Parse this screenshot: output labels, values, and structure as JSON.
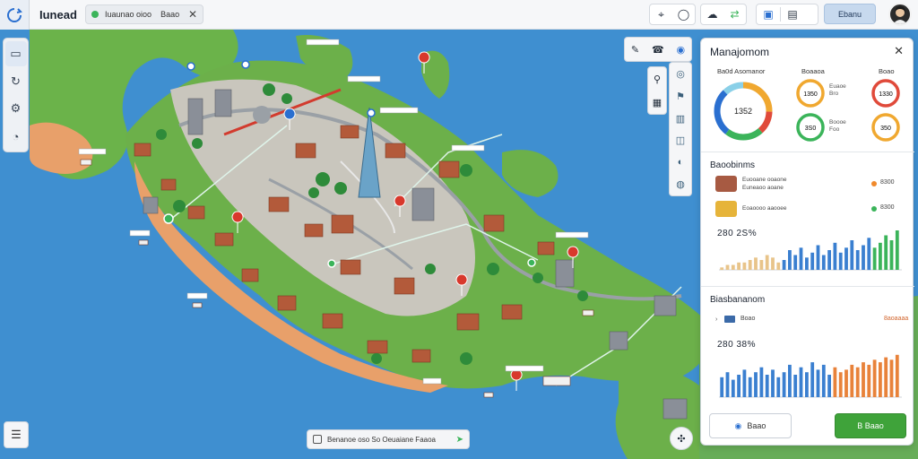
{
  "app": {
    "title": "Iunead",
    "logo": "refresh-circle-icon"
  },
  "search_chip": {
    "text": "Iuaunao oioo",
    "text2": "Baao",
    "status_color": "#3bb45a"
  },
  "toolbar": {
    "share_label": "Ebanu",
    "icons": [
      "location-icon",
      "circle-icon",
      "weather-icon",
      "transfer-icon",
      "photo-icon",
      "panel-icon"
    ]
  },
  "left_tools": [
    "map-icon",
    "route-icon",
    "settings-icon",
    "time-icon"
  ],
  "right_tools": {
    "top": [
      "pencil-icon",
      "phone-icon",
      "globe-icon"
    ],
    "col1": [
      "pin-icon",
      "cube-icon"
    ],
    "col2": [
      "globe-icon",
      "flag-icon",
      "bus-icon",
      "layers-icon",
      "speed-icon",
      "eye-icon"
    ]
  },
  "status_chip": {
    "text": "Benanoe oso So Oeuaiane Faaoa"
  },
  "panel": {
    "title": "Manajomom",
    "overview_label": "Ba0d Asomanor",
    "donut_value": "1352",
    "rings": [
      {
        "title": "Boaaoa",
        "value": "1350",
        "color": "#f0a830",
        "side": [
          "Euaoe",
          "Bro"
        ]
      },
      {
        "title": "Boao",
        "value": "1330",
        "color": "#e04a3a",
        "side": []
      },
      {
        "title": "",
        "value": "3S0",
        "color": "#3bb45a",
        "side": [
          "Boooe",
          "Foo"
        ]
      },
      {
        "title": "",
        "value": "350",
        "color": "#f0a830",
        "side": []
      }
    ],
    "section1_title": "Baoobinms",
    "legend1": [
      {
        "name": "Euooane ooaone",
        "sub": "Euneaoo aoane",
        "value": "8300",
        "dot": "#f08a2c",
        "thumb": "#a75a42"
      },
      {
        "name": "Eoaoooo aaooee",
        "sub": "",
        "value": "8300",
        "dot": "#3bb45a",
        "thumb": "#e6b43a"
      }
    ],
    "stat1": "280 2S%",
    "section2_title": "Biasbananom",
    "row2": {
      "text": "Boao",
      "value": "8aoaaaa"
    },
    "stat2": "280 38%",
    "reset_label": "Baao",
    "apply_label": "B Baao"
  },
  "chart_data": [
    {
      "type": "bar",
      "title": "",
      "categories": [
        "1",
        "2",
        "3",
        "4",
        "5",
        "6",
        "7",
        "8",
        "9",
        "10",
        "11",
        "12",
        "13",
        "14",
        "15",
        "16",
        "17",
        "18",
        "19",
        "20",
        "21",
        "22",
        "23",
        "24",
        "25",
        "26",
        "27",
        "28",
        "29",
        "30",
        "31",
        "32"
      ],
      "series": [
        {
          "values": [
            1,
            2,
            2,
            3,
            3,
            4,
            5,
            4,
            6,
            5,
            3,
            4,
            8,
            6,
            9,
            5,
            7,
            10,
            6,
            8,
            11,
            7,
            9,
            12,
            8,
            10,
            13,
            9,
            11,
            14,
            12,
            16
          ]
        }
      ],
      "colors_rule": "first third orange-tan, then blue, last few green",
      "ylim": [
        0,
        16
      ]
    },
    {
      "type": "bar",
      "title": "",
      "categories": [
        "1",
        "2",
        "3",
        "4",
        "5",
        "6",
        "7",
        "8",
        "9",
        "10",
        "11",
        "12",
        "13",
        "14",
        "15",
        "16",
        "17",
        "18",
        "19",
        "20",
        "21",
        "22",
        "23",
        "24",
        "25",
        "26",
        "27",
        "28",
        "29",
        "30",
        "31",
        "32"
      ],
      "series": [
        {
          "values": [
            8,
            10,
            7,
            9,
            11,
            8,
            10,
            12,
            9,
            11,
            8,
            10,
            13,
            9,
            12,
            10,
            14,
            11,
            13,
            9,
            12,
            10,
            11,
            13,
            12,
            14,
            13,
            15,
            14,
            16,
            15,
            17
          ]
        }
      ],
      "colors_rule": "blue then orange",
      "ylim": [
        0,
        18
      ]
    }
  ]
}
